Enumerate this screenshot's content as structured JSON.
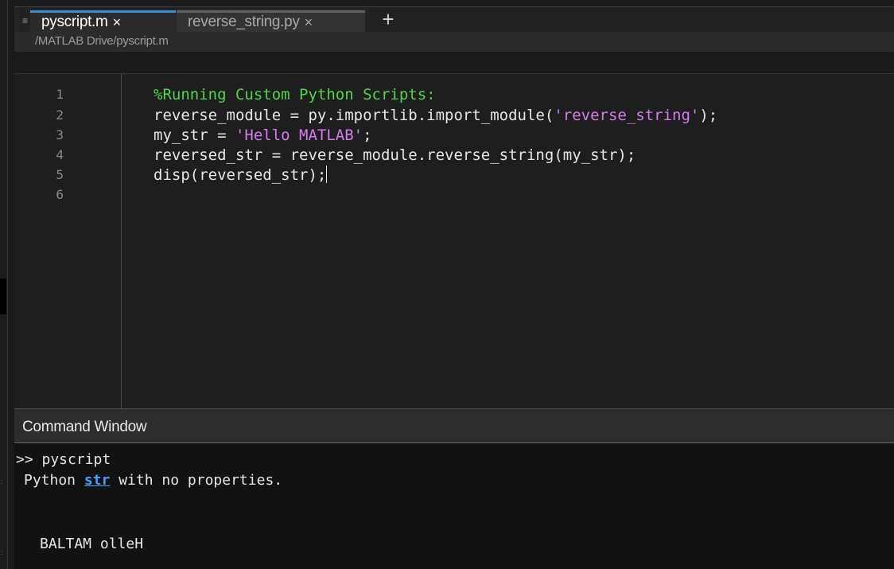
{
  "tabs": [
    {
      "label": "pyscript.m",
      "close": "×",
      "active": true
    },
    {
      "label": "reverse_string.py",
      "close": "×",
      "active": false
    }
  ],
  "new_tab_label": "+",
  "menu_icon": "≡",
  "breadcrumb": "/MATLAB Drive/pyscript.m",
  "editor": {
    "line_numbers": [
      "1",
      "2",
      "3",
      "4",
      "5",
      "6"
    ],
    "lines": {
      "l1_comment": "%Running Custom Python Scripts:",
      "l2_pre": "reverse_module = py.importlib.import_module(",
      "l2_str": "'reverse_string'",
      "l2_post": ");",
      "l3_pre": "my_str = ",
      "l3_str": "'Hello MATLAB'",
      "l3_post": ";",
      "l4": "reversed_str = reverse_module.reverse_string(my_str);",
      "l5": "disp(reversed_str);"
    }
  },
  "command_window": {
    "title": "Command Window",
    "prompt_line": ">> pyscript",
    "info_pre": "Python ",
    "info_link": "str",
    "info_post": " with no properties.",
    "output": "BALTAM olleH"
  },
  "colors": {
    "comment": "#4fd64a",
    "string": "#d67bf0",
    "active_tab_accent": "#3d8fd6",
    "link": "#3fa0ff"
  }
}
